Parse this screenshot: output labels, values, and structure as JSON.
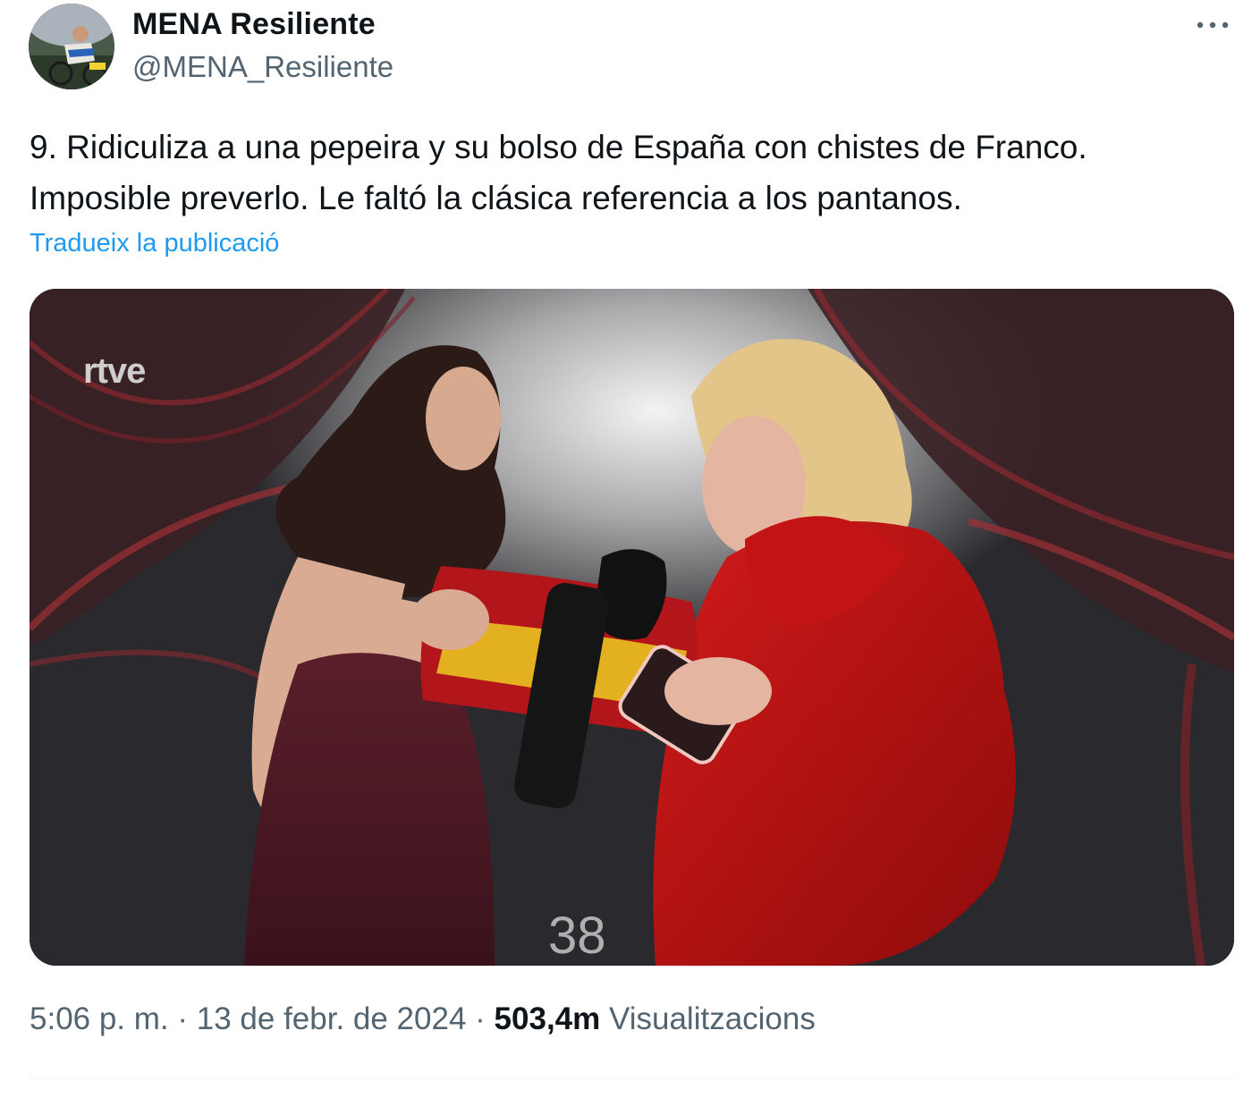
{
  "author": {
    "name": "MENA Resiliente",
    "handle": "@MENA_Resiliente"
  },
  "tweet": {
    "text_lines": [
      "9. Ridiculiza a una pepeira y su bolso de España con chistes de Franco.",
      "Imposible preverlo. Le faltó la clásica referencia a los pantanos."
    ],
    "translate_label": "Tradueix la publicació"
  },
  "media": {
    "watermark": "rtve",
    "mic_logo": "rtve",
    "counter": "38"
  },
  "meta": {
    "time": "5:06 p. m.",
    "separator": "·",
    "date": "13 de febr. de 2024",
    "views_count": "503,4m",
    "views_label": "Visualitzacions"
  },
  "icons": {
    "more": "more-horizontal-icon"
  },
  "colors": {
    "link": "#1d9bf0",
    "secondary_text": "#536471",
    "primary_text": "#0f1419"
  }
}
